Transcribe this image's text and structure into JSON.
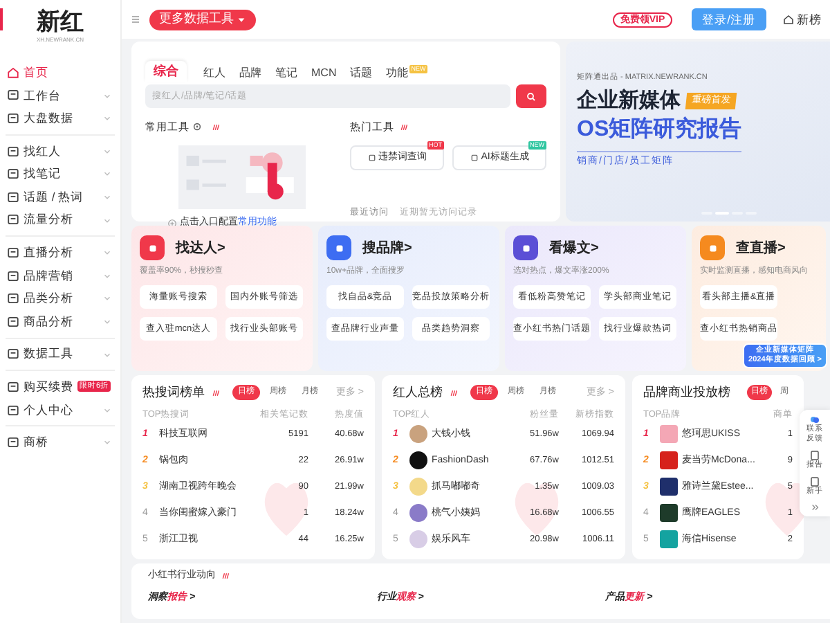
{
  "sidebar": {
    "logo": "新红",
    "logo_sub": "XH.NEWRANK.CN",
    "groups": [
      [
        {
          "label": "首页",
          "selected": true,
          "expandable": false
        },
        {
          "label": "工作台",
          "selected": false,
          "expandable": true
        },
        {
          "label": "大盘数据",
          "selected": false,
          "expandable": true
        }
      ],
      [
        {
          "label": "找红人",
          "selected": false,
          "expandable": true
        },
        {
          "label": "找笔记",
          "selected": false,
          "expandable": true
        },
        {
          "label": "话题 / 热词",
          "selected": false,
          "expandable": true
        },
        {
          "label": "流量分析",
          "selected": false,
          "expandable": true
        }
      ],
      [
        {
          "label": "直播分析",
          "selected": false,
          "expandable": true
        },
        {
          "label": "品牌营销",
          "selected": false,
          "expandable": true
        },
        {
          "label": "品类分析",
          "selected": false,
          "expandable": true
        },
        {
          "label": "商品分析",
          "selected": false,
          "expandable": true
        }
      ],
      [
        {
          "label": "数据工具",
          "selected": false,
          "expandable": true
        }
      ],
      [
        {
          "label": "购买续费",
          "selected": false,
          "expandable": false,
          "badge": "限时6折"
        },
        {
          "label": "个人中心",
          "selected": false,
          "expandable": true
        }
      ],
      [
        {
          "label": "商桥",
          "selected": false,
          "expandable": true
        }
      ]
    ]
  },
  "topbar": {
    "tools_button": "更多数据工具",
    "vip_badge": "免费领VIP",
    "login_button": "登录/注册",
    "home_link": "新榜"
  },
  "search": {
    "tabs": [
      {
        "label": "综合",
        "selected": true
      },
      {
        "label": "红人",
        "selected": false
      },
      {
        "label": "品牌",
        "selected": false
      },
      {
        "label": "笔记",
        "selected": false
      },
      {
        "label": "MCN",
        "selected": false
      },
      {
        "label": "话题",
        "selected": false
      },
      {
        "label": "功能",
        "selected": false,
        "badge": "NEW"
      }
    ],
    "placeholder": "搜红人/品牌/笔记/话题",
    "common_tools": {
      "title": "常用工具",
      "hint_lead": "点击入口配置",
      "hint_link": "常用功能"
    },
    "hot_tools": {
      "title": "热门工具",
      "items": [
        {
          "label": "违禁词查询",
          "badge": "HOT",
          "color": "#f0384a"
        },
        {
          "label": "AI标题生成",
          "badge": "NEW",
          "color": "#2fc6a0"
        }
      ]
    },
    "recent": {
      "label": "最近访问",
      "empty": "近期暂无访问记录"
    }
  },
  "banner": {
    "source": "矩阵通出品 - MATRIX.NEWRANK.CN",
    "headline": "企业新媒体",
    "tag": "重磅首发",
    "subheadline": "OS矩阵研究报告",
    "tagline": "销商/门店/员工矩阵",
    "slides": [
      {
        "selected": false
      },
      {
        "selected": true
      },
      {
        "selected": false
      },
      {
        "selected": false
      }
    ]
  },
  "feature_cards": [
    {
      "title": "找达人>",
      "subtitle": "覆盖率90%，秒搜秒查",
      "color": "#f0384a",
      "links": [
        "海量账号搜索",
        "查入驻mcn达人",
        "国内外账号筛选",
        "找行业头部账号"
      ]
    },
    {
      "title": "搜品牌>",
      "subtitle": "10w+品牌，全面搜罗",
      "color": "#3d6df2",
      "links": [
        "找自品&竞品",
        "查品牌行业声量",
        "竞品投放策略分析",
        "品类趋势洞察"
      ]
    },
    {
      "title": "看爆文>",
      "subtitle": "选对热点，爆文率涨200%",
      "color": "#5b4fd6",
      "links": [
        "看低粉高赞笔记",
        "查小红书热门话题",
        "学头部商业笔记",
        "找行业爆款热词"
      ]
    },
    {
      "title": "查直播>",
      "subtitle": "实时监测直播，感知电商风向",
      "color": "#f58a1f",
      "links": [
        "看头部主播&直播",
        "查小红书热销商品"
      ]
    }
  ],
  "promo": {
    "lines": [
      "企业新媒体矩阵",
      "2024年度数据回顾 >"
    ]
  },
  "rankings": [
    {
      "kind": "keyword",
      "title": "热搜词榜单",
      "periods": [
        {
          "label": "日榜",
          "selected": true
        },
        {
          "label": "周榜",
          "selected": false
        },
        {
          "label": "月榜",
          "selected": false
        }
      ],
      "more": "更多 >",
      "columns": [
        "TOP热搜词",
        "相关笔记数",
        "热度值"
      ],
      "rows": [
        {
          "rank": "1",
          "cells": [
            "科技互联网",
            "5191",
            "40.68w"
          ]
        },
        {
          "rank": "2",
          "cells": [
            "锅包肉",
            "22",
            "26.91w"
          ]
        },
        {
          "rank": "3",
          "cells": [
            "湖南卫视跨年晚会",
            "90",
            "21.99w"
          ]
        },
        {
          "rank": "4",
          "cells": [
            "当你闺蜜嫁入豪门",
            "1",
            "18.24w"
          ]
        },
        {
          "rank": "5",
          "cells": [
            "浙江卫视",
            "44",
            "16.25w"
          ]
        }
      ]
    },
    {
      "kind": "creator",
      "title": "红人总榜",
      "periods": [
        {
          "label": "日榜",
          "selected": true
        },
        {
          "label": "周榜",
          "selected": false
        },
        {
          "label": "月榜",
          "selected": false
        }
      ],
      "more": "更多 >",
      "columns": [
        "TOP红人",
        "粉丝量",
        "新榜指数"
      ],
      "rows": [
        {
          "rank": "1",
          "color": "#c9a27e",
          "cells": [
            "大钱小钱",
            "51.96w",
            "1069.94"
          ]
        },
        {
          "rank": "2",
          "color": "#111111",
          "cells": [
            "FashionDash",
            "67.76w",
            "1012.51"
          ]
        },
        {
          "rank": "3",
          "color": "#f3d98a",
          "cells": [
            "抓马嘟嘟奇",
            "1.35w",
            "1009.03"
          ]
        },
        {
          "rank": "4",
          "color": "#8a7bc8",
          "cells": [
            "桃气小姨妈",
            "16.68w",
            "1006.55"
          ]
        },
        {
          "rank": "5",
          "color": "#d8cde6",
          "cells": [
            "娱乐风车",
            "20.98w",
            "1006.11"
          ]
        }
      ]
    },
    {
      "kind": "brand",
      "title": "品牌商业投放榜",
      "periods": [
        {
          "label": "日榜",
          "selected": true
        },
        {
          "label": "周",
          "selected": false
        }
      ],
      "columns": [
        "TOP品牌",
        "商单"
      ],
      "rows": [
        {
          "rank": "1",
          "color": "#f4a7b5",
          "cells": [
            "悠珂思UKISS",
            "1"
          ]
        },
        {
          "rank": "2",
          "color": "#d6221c",
          "cells": [
            "麦当劳McDona...",
            "9"
          ]
        },
        {
          "rank": "3",
          "color": "#1f2f6b",
          "cells": [
            "雅诗兰黛Estee...",
            "5"
          ]
        },
        {
          "rank": "4",
          "color": "#1e3b2a",
          "cells": [
            "鹰牌EAGLES",
            "1"
          ]
        },
        {
          "rank": "5",
          "color": "#14a3a0",
          "cells": [
            "海信Hisense",
            "2"
          ]
        }
      ]
    }
  ],
  "right_rail": [
    {
      "label": "联系反馈"
    },
    {
      "label": "报告"
    },
    {
      "label": "新手"
    }
  ],
  "industry": {
    "title": "小红书行业动向",
    "sections": [
      {
        "lead": "洞察",
        "accent": "报告",
        "tail": ">"
      },
      {
        "lead": "行业",
        "accent": "观察",
        "tail": ">"
      },
      {
        "lead": "产品",
        "accent": "更新",
        "tail": ">"
      }
    ]
  }
}
